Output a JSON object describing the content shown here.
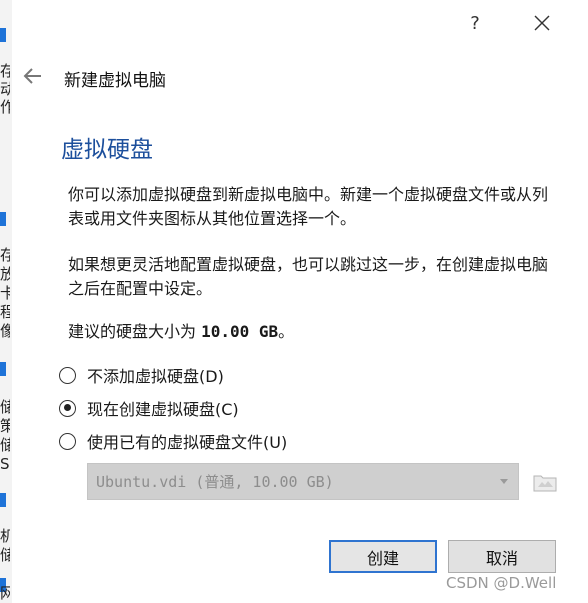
{
  "background_window": {
    "chips": [
      "存",
      "动",
      "作",
      "存",
      "放",
      "卡",
      "程",
      "像",
      "储",
      "策",
      "储",
      "S.",
      "机",
      "储",
      "网络"
    ]
  },
  "dialog": {
    "help_glyph": "?",
    "header_title": "新建虚拟电脑",
    "page_heading": "虚拟硬盘",
    "paragraph1": "你可以添加虚拟硬盘到新虚拟电脑中。新建一个虚拟硬盘文件或从列表或用文件夹图标从其他位置选择一个。",
    "paragraph2": "如果想更灵活地配置虚拟硬盘，也可以跳过这一步，在创建虚拟电脑之后在配置中设定。",
    "recommend_prefix": "建议的硬盘大小为 ",
    "recommend_size": "10.00 GB",
    "recommend_suffix": "。",
    "options": [
      {
        "label": "不添加虚拟硬盘(D)",
        "checked": false
      },
      {
        "label": "现在创建虚拟硬盘(C)",
        "checked": true
      },
      {
        "label": "使用已有的虚拟硬盘文件(U)",
        "checked": false
      }
    ],
    "existing_disk_value": "Ubuntu.vdi (普通, 10.00 GB)",
    "create_label": "创建",
    "cancel_label": "取消",
    "accent_color": "#1c4f9c"
  },
  "watermark": "CSDN @D.Well"
}
